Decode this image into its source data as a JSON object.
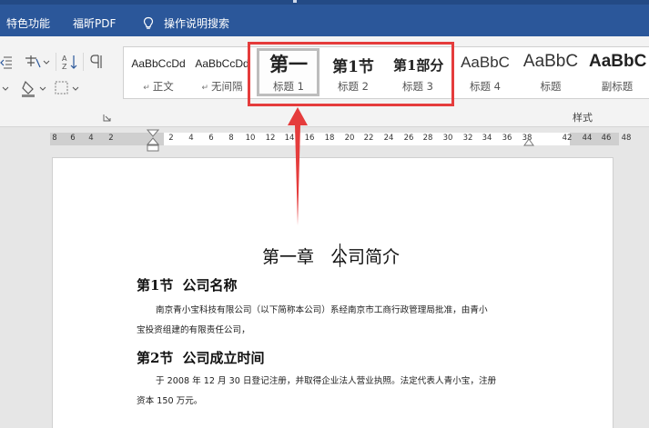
{
  "tabs": [
    "特色功能",
    "福昕PDF",
    "操作说明搜索"
  ],
  "styles_gallery": {
    "items": [
      {
        "preview": "AaBbCcDd",
        "label": "正文",
        "has_mark": true
      },
      {
        "preview": "AaBbCcDd",
        "label": "无间隔",
        "has_mark": true
      },
      {
        "preview": "第一",
        "label": "标题 1"
      },
      {
        "preview": "第1节",
        "label": "标题 2"
      },
      {
        "preview": "第1部分",
        "label": "标题 3"
      },
      {
        "preview": "AaBbC",
        "label": "标题 4"
      },
      {
        "preview": "AaBbC",
        "label": "标题"
      },
      {
        "preview": "AaBbC",
        "label": "副标题"
      }
    ],
    "group_label": "样式"
  },
  "ruler": {
    "numbers": [
      "8",
      "6",
      "4",
      "2",
      "2",
      "4",
      "6",
      "8",
      "10",
      "12",
      "14",
      "16",
      "18",
      "20",
      "22",
      "24",
      "26",
      "28",
      "30",
      "32",
      "34",
      "36",
      "38",
      "42",
      "44",
      "46",
      "48"
    ]
  },
  "document": {
    "title_chapter": "第一章",
    "title_name": "公司简介",
    "section1_num": "第1节",
    "section1_title": "公司名称",
    "section1_line1": "南京青小宝科技有限公司（以下简称本公司）系经南京市工商行政管理局批准，由青小",
    "section1_line2": "宝投资组建的有限责任公司，",
    "section2_num": "第2节",
    "section2_title": "公司成立时间",
    "section2_line1": "于 2008 年 12 月 30 日登记注册，并取得企业法人营业执照。法定代表人青小宝，注册",
    "section2_line2": "资本 150 万元。"
  },
  "colors": {
    "title_bar": "#2b579a",
    "annotation": "#e53c3c"
  }
}
